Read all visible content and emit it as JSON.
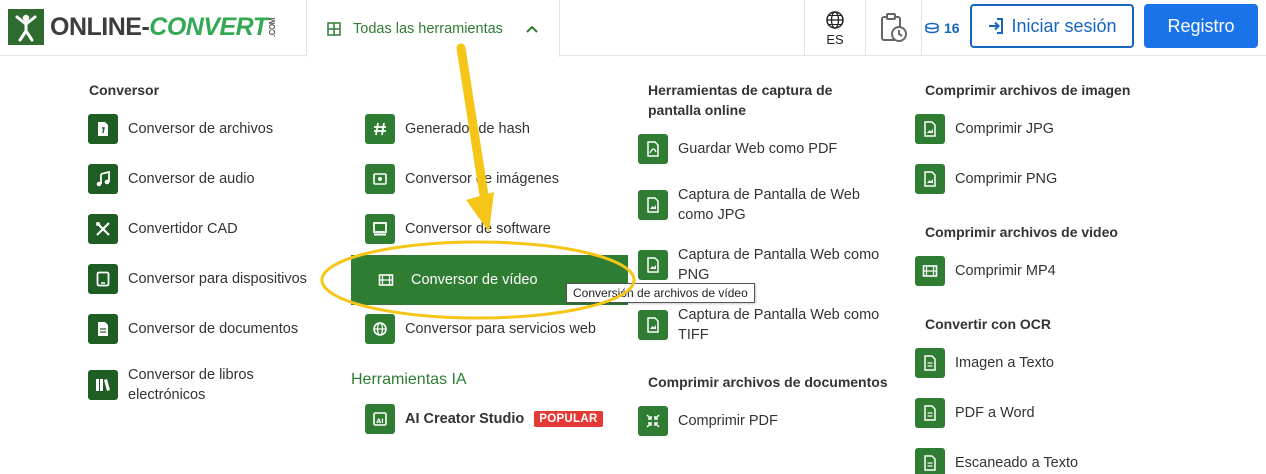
{
  "header": {
    "logo_main": "ONLINE-",
    "logo_accent": "CONVERT",
    "logo_com": ".COM",
    "tools_label": "Todas las herramientas",
    "lang_code": "ES",
    "credits": "16",
    "login_label": "Iniciar sesión",
    "register_label": "Registro"
  },
  "colors": {
    "green": "#2e7d32",
    "blue": "#1a73e8",
    "highlight": "#f5c518",
    "badge": "#e53935"
  },
  "col1": {
    "title": "Conversor",
    "items": [
      {
        "label": "Conversor de archivos",
        "icon": "file-icon"
      },
      {
        "label": "Conversor de audio",
        "icon": "music-icon"
      },
      {
        "label": "Convertidor CAD",
        "icon": "tools-icon"
      },
      {
        "label": "Conversor para dispositivos",
        "icon": "tablet-icon"
      },
      {
        "label": "Conversor de documentos",
        "icon": "document-icon"
      },
      {
        "label": "Conversor de libros electrónicos",
        "icon": "books-icon"
      }
    ]
  },
  "col2": {
    "items": [
      {
        "label": "Generador de hash",
        "icon": "hash-icon"
      },
      {
        "label": "Conversor de imágenes",
        "icon": "image-icon"
      },
      {
        "label": "Conversor de software",
        "icon": "monitor-icon"
      },
      {
        "label": "Conversor de vídeo",
        "icon": "film-icon"
      },
      {
        "label": "Conversor para servicios web",
        "icon": "globe-icon"
      }
    ],
    "ai_title": "Herramientas IA",
    "ai_item": {
      "label": "AI Creator Studio",
      "badge": "POPULAR",
      "icon": "ai-image-icon"
    }
  },
  "col3": {
    "title": "Herramientas de captura de pantalla online",
    "items": [
      {
        "label": "Guardar Web como PDF",
        "icon": "pdf-icon"
      },
      {
        "label": "Captura de Pantalla de Web como JPG",
        "icon": "image-file-icon"
      },
      {
        "label": "Captura de Pantalla Web como PNG",
        "icon": "image-file-icon"
      },
      {
        "label": "Captura de Pantalla Web como TIFF",
        "icon": "image-file-icon"
      }
    ],
    "doc_title": "Comprimir archivos de documentos",
    "doc_item": {
      "label": "Comprimir PDF",
      "icon": "compress-icon"
    }
  },
  "col4": {
    "img_title": "Comprimir archivos de imagen",
    "img_items": [
      {
        "label": "Comprimir JPG",
        "icon": "image-file-icon"
      },
      {
        "label": "Comprimir PNG",
        "icon": "image-file-icon"
      }
    ],
    "video_title": "Comprimir archivos de video",
    "video_item": {
      "label": "Comprimir MP4",
      "icon": "film-icon"
    },
    "ocr_title": "Convertir con OCR",
    "ocr_items": [
      {
        "label": "Imagen a Texto",
        "icon": "text-file-icon"
      },
      {
        "label": "PDF a Word",
        "icon": "text-file-icon"
      },
      {
        "label": "Escaneado a Texto",
        "icon": "text-file-icon"
      }
    ]
  },
  "tooltip": "Conversión de archivos de vídeo"
}
